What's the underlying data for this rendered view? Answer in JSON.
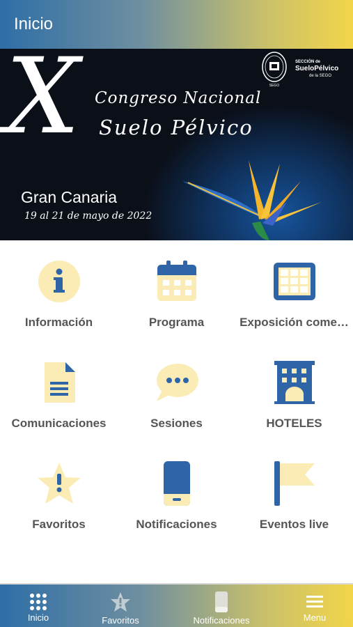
{
  "header": {
    "title": "Inicio"
  },
  "banner": {
    "big_numeral": "X",
    "line1": "Congreso Nacional",
    "line2": "Suelo Pélvico",
    "city": "Gran Canaria",
    "dates": "19 al 21 de mayo de 2022",
    "section_small": "SECCIÓN de",
    "section_name": "SueloPélvico",
    "section_org": "de la SEGO"
  },
  "grid": {
    "items": [
      {
        "label": "Información",
        "icon": "info-icon"
      },
      {
        "label": "Programa",
        "icon": "calendar-icon"
      },
      {
        "label": "Exposición come…",
        "icon": "exhibition-icon"
      },
      {
        "label": "Comunicaciones",
        "icon": "document-icon"
      },
      {
        "label": "Sesiones",
        "icon": "chat-bubble-icon"
      },
      {
        "label": "HOTELES",
        "icon": "hotel-icon"
      },
      {
        "label": "Favoritos",
        "icon": "star-icon"
      },
      {
        "label": "Notificaciones",
        "icon": "phone-icon"
      },
      {
        "label": "Eventos live",
        "icon": "flag-icon"
      }
    ]
  },
  "tabbar": {
    "items": [
      {
        "label": "Inicio",
        "icon": "grid-icon"
      },
      {
        "label": "Favoritos",
        "icon": "star-icon"
      },
      {
        "label": "Notificaciones",
        "icon": "phone-icon"
      },
      {
        "label": "Menu",
        "icon": "hamburger-icon"
      }
    ]
  },
  "colors": {
    "icon_blue": "#2f65a7",
    "icon_yellow": "#fbecb5",
    "label_gray": "#555555",
    "gradient_start": "#2e6ea6",
    "gradient_end": "#f3d54a"
  }
}
